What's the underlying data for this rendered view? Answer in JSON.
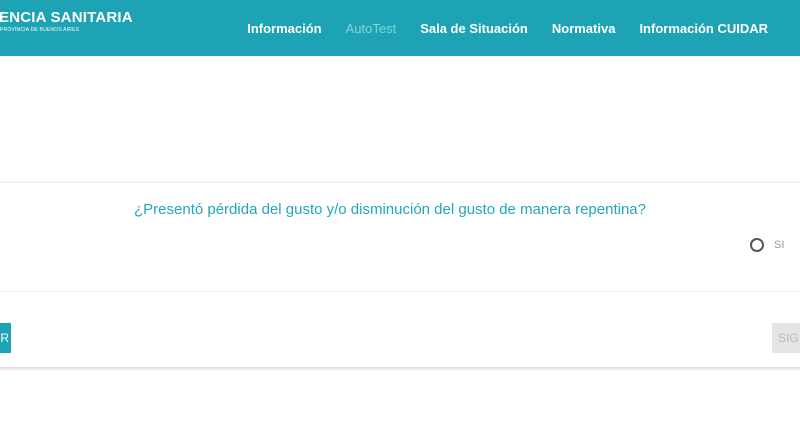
{
  "header": {
    "brand_title": "ENCIA SANITARIA",
    "brand_subtitle": "PROVINCIA DE BUENOS AIRES",
    "nav": [
      {
        "label": "Información",
        "active": false
      },
      {
        "label": "AutoTest",
        "active": true
      },
      {
        "label": "Sala de Situación",
        "active": false
      },
      {
        "label": "Normativa",
        "active": false
      },
      {
        "label": "Información CUIDAR",
        "active": false
      }
    ]
  },
  "question": {
    "text": "¿Presentó pérdida del gusto y/o disminución del gusto de manera repentina?",
    "options": [
      {
        "label": "SI",
        "selected": false
      }
    ]
  },
  "footer": {
    "back_label": "R",
    "next_label": "SIG"
  },
  "colors": {
    "header_bg": "#1ea3b4",
    "accent": "#23a7bb",
    "nav_active": "#7fd4df",
    "disabled_bg": "#e4e4e4"
  }
}
